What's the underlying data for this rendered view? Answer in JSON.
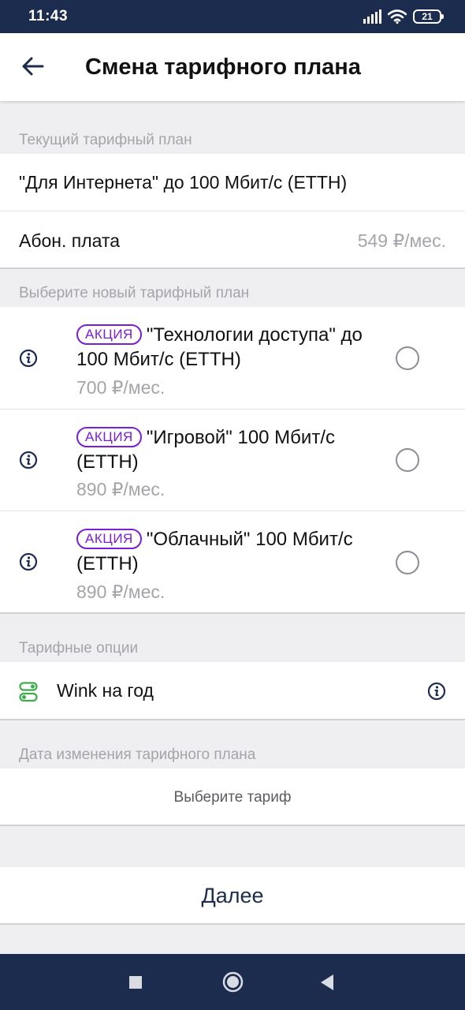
{
  "status_bar": {
    "time": "11:43",
    "battery": "21"
  },
  "header": {
    "title": "Смена тарифного плана"
  },
  "current_plan": {
    "section_label": "Текущий тарифный план",
    "name": "\"Для Интернета\" до 100 Мбит/с (ETTH)",
    "fee_label": "Абон. плата",
    "fee_value": "549 ₽/мес."
  },
  "new_plan": {
    "section_label": "Выберите новый тарифный план",
    "plans": [
      {
        "badge": "АКЦИЯ",
        "name": "\"Технологии доступа\" до 100 Мбит/с (ETTH)",
        "price": "700 ₽/мес."
      },
      {
        "badge": "АКЦИЯ",
        "name": "\"Игровой\" 100 Мбит/с (ETTH)",
        "price": "890 ₽/мес."
      },
      {
        "badge": "АКЦИЯ",
        "name": "\"Облачный\" 100 Мбит/с (ETTH)",
        "price": "890 ₽/мес."
      }
    ]
  },
  "options": {
    "section_label": "Тарифные опции",
    "items": [
      {
        "name": "Wink на год",
        "icon": "toggle-option-icon"
      }
    ]
  },
  "change_date": {
    "section_label": "Дата изменения тарифного плана",
    "placeholder": "Выберите тариф"
  },
  "actions": {
    "next_label": "Далее"
  },
  "colors": {
    "accent": "#1c2c4f",
    "promo": "#7a1fd6",
    "option_green": "#3fae4a",
    "muted": "#a4a5ab"
  }
}
